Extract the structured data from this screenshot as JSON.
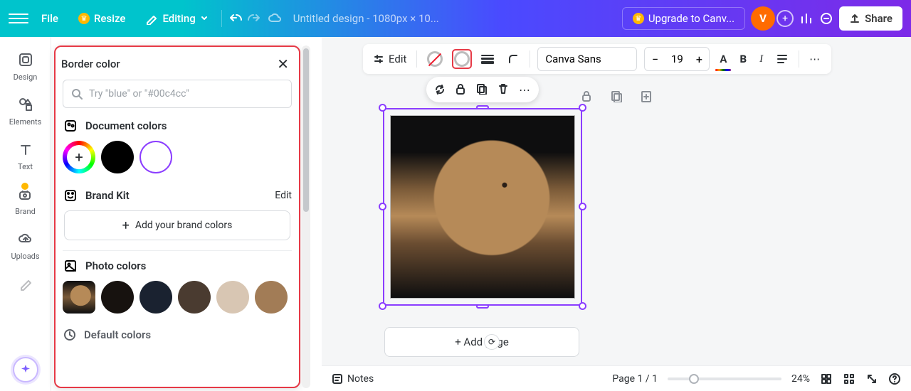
{
  "topbar": {
    "file": "File",
    "resize": "Resize",
    "editing": "Editing",
    "doc_title": "Untitled design - 1080px × 10...",
    "upgrade": "Upgrade to Canv...",
    "avatar_initial": "V",
    "share": "Share"
  },
  "leftrail": {
    "design": "Design",
    "elements": "Elements",
    "text": "Text",
    "brand": "Brand",
    "uploads": "Uploads"
  },
  "panel": {
    "title": "Border color",
    "search_placeholder": "Try \"blue\" or \"#00c4cc\"",
    "doc_colors": "Document colors",
    "brand_kit": "Brand Kit",
    "brand_kit_edit": "Edit",
    "add_brand": "Add your brand colors",
    "photo_colors": "Photo colors",
    "default_colors": "Default colors",
    "photo_swatches": [
      "#17120f",
      "#1a2230",
      "#4a3b30",
      "#d8c6b3",
      "#a27c56"
    ]
  },
  "context_toolbar": {
    "edit": "Edit",
    "font": "Canva Sans",
    "size": "19"
  },
  "canvas": {
    "add_page": "+ Add page"
  },
  "bottombar": {
    "notes": "Notes",
    "page_indicator": "Page 1 / 1",
    "zoom": "24%"
  }
}
